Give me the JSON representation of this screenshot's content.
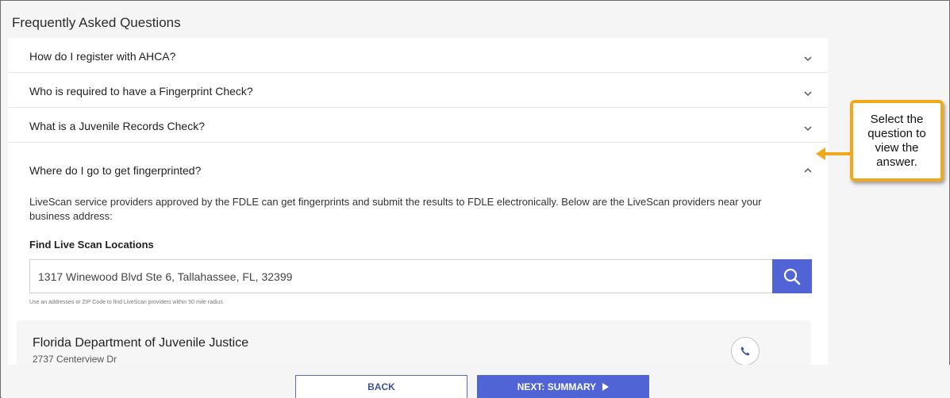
{
  "page_title": "Frequently Asked Questions",
  "faq": [
    {
      "question": "How do I register with AHCA?",
      "expanded": false
    },
    {
      "question": "Who is required to have a Fingerprint Check?",
      "expanded": false
    },
    {
      "question": "What is a Juvenile Records Check?",
      "expanded": false
    },
    {
      "question": "Where do I go to get fingerprinted?",
      "expanded": true
    }
  ],
  "answer": {
    "text": "LiveScan service providers approved by the FDLE can get fingerprints and submit the results to FDLE electronically. Below are the LiveScan providers near your business address:",
    "find_label": "Find Live Scan Locations",
    "search_value": "1317 Winewood Blvd Ste 6, Tallahassee, FL, 32399",
    "hint": "Use an addresses or ZIP Code to find LiveScan providers within 50 mile radius",
    "result": {
      "name": "Florida Department of Juvenile Justice",
      "address": "2737 Centerview Dr"
    }
  },
  "footer": {
    "back_label": "BACK",
    "next_label": "NEXT: SUMMARY"
  },
  "callout": {
    "text": "Select the question to view the answer."
  },
  "colors": {
    "accent": "#5064d6",
    "callout_border": "#f2a81d"
  },
  "icons": {
    "chevron_down": "chevron-down-icon",
    "chevron_up": "chevron-up-icon",
    "search": "search-icon",
    "phone": "phone-icon",
    "play": "play-icon"
  }
}
